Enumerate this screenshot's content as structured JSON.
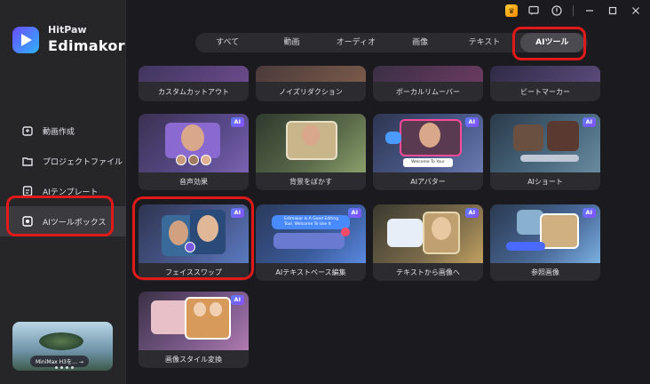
{
  "app": {
    "brand_top": "HitPaw",
    "brand_name": "Edimakor"
  },
  "sidebar": {
    "items": [
      {
        "label": "動画作成",
        "icon": "video-create-icon"
      },
      {
        "label": "プロジェクトファイル",
        "icon": "folder-icon"
      },
      {
        "label": "AIテンプレート",
        "icon": "ai-template-icon"
      },
      {
        "label": "AIツールボックス",
        "icon": "toolbox-icon",
        "active": true
      }
    ],
    "promo": {
      "pill_text": "MiniMax H3を…  →"
    }
  },
  "tabs": [
    {
      "label": "すべて"
    },
    {
      "label": "動画"
    },
    {
      "label": "オーディオ"
    },
    {
      "label": "画像"
    },
    {
      "label": "テキスト"
    },
    {
      "label": "AIツール",
      "active": true
    }
  ],
  "cards": {
    "row0": [
      {
        "label": "カスタムカットアウト"
      },
      {
        "label": "ノイズリダクション"
      },
      {
        "label": "ボーカルリムーバー"
      },
      {
        "label": "ビートマーカー"
      }
    ],
    "row1": [
      {
        "label": "音声効果",
        "badge": "AI"
      },
      {
        "label": "背景をぼかす",
        "badge": "AI"
      },
      {
        "label": "AIアバター",
        "badge": "AI"
      },
      {
        "label": "AIショート",
        "badge": "AI"
      }
    ],
    "row2": [
      {
        "label": "フェイススワップ",
        "badge": "AI"
      },
      {
        "label": "AIテキストベース編集",
        "badge": "AI"
      },
      {
        "label": "テキストから画像へ",
        "badge": "AI"
      },
      {
        "label": "参照画像",
        "badge": "AI"
      }
    ],
    "row3": [
      {
        "label": "画像スタイル変換",
        "badge": "AI"
      }
    ]
  },
  "thumb_texts": {
    "avatar_caption": "Welcome To Your",
    "text_edit_caption": "Edimakor Is A Good Editing Tool. Welcome To Use It"
  },
  "colors": {
    "highlight": "#e01919",
    "ai_badge": "#6a6aff",
    "background": "#1b1b1f",
    "sidebar": "#262629"
  }
}
